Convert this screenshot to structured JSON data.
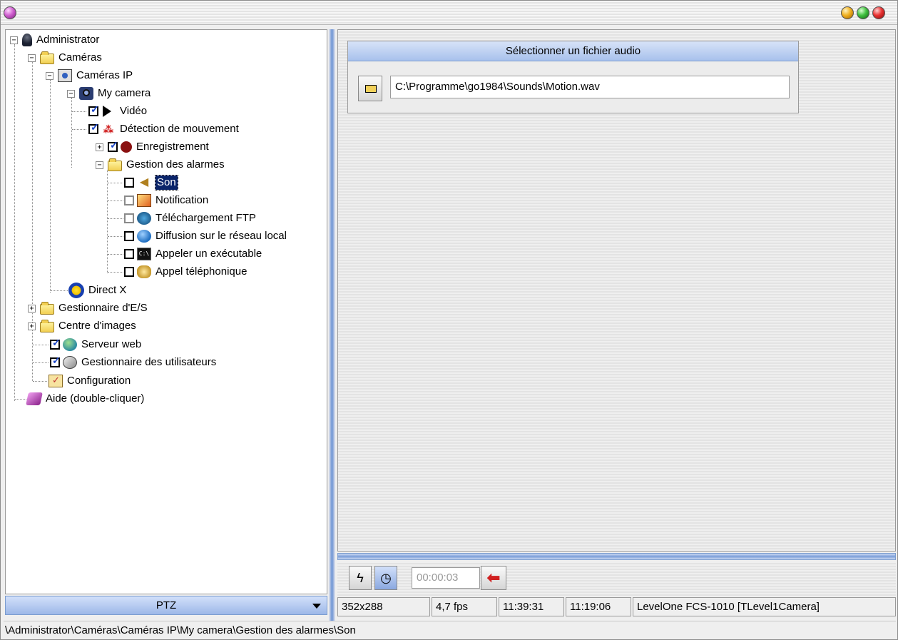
{
  "window": {
    "title_buttons": [
      "menu",
      "minimize",
      "maximize",
      "close"
    ]
  },
  "tree": {
    "administrator": "Administrator",
    "cameras": "Caméras",
    "cameras_ip": "Caméras IP",
    "my_camera": "My camera",
    "video": "Vidéo",
    "motion": "Détection de mouvement",
    "recording": "Enregistrement",
    "alarms": "Gestion des alarmes",
    "son": "Son",
    "notification": "Notification",
    "ftp": "Téléchargement FTP",
    "broadcast": "Diffusion sur le réseau local",
    "exec": "Appeler un exécutable",
    "phone": "Appel téléphonique",
    "directx": "Direct X",
    "io_manager": "Gestionnaire d'E/S",
    "image_center": "Centre d'images",
    "web_server": "Serveur web",
    "user_manager": "Gestionnaire des utilisateurs",
    "configuration": "Configuration",
    "help": "Aide (double-cliquer)"
  },
  "audio_panel": {
    "header": "Sélectionner un fichier audio",
    "file_path": "C:\\Programme\\go1984\\Sounds\\Motion.wav"
  },
  "toolbar": {
    "time_value": "00:00:03"
  },
  "ptz": {
    "label": "PTZ"
  },
  "status": {
    "resolution": "352x288",
    "fps": "4,7 fps",
    "time1": "11:39:31",
    "time2": "11:19:06",
    "camera": "LevelOne FCS-1010 [TLevel1Camera]"
  },
  "path": "\\Administrator\\Caméras\\Caméras IP\\My camera\\Gestion des alarmes\\Son",
  "colors": {
    "selection": "#0a246a",
    "accent_blue": "#7c9ed8",
    "check_blue": "#1844c8"
  }
}
